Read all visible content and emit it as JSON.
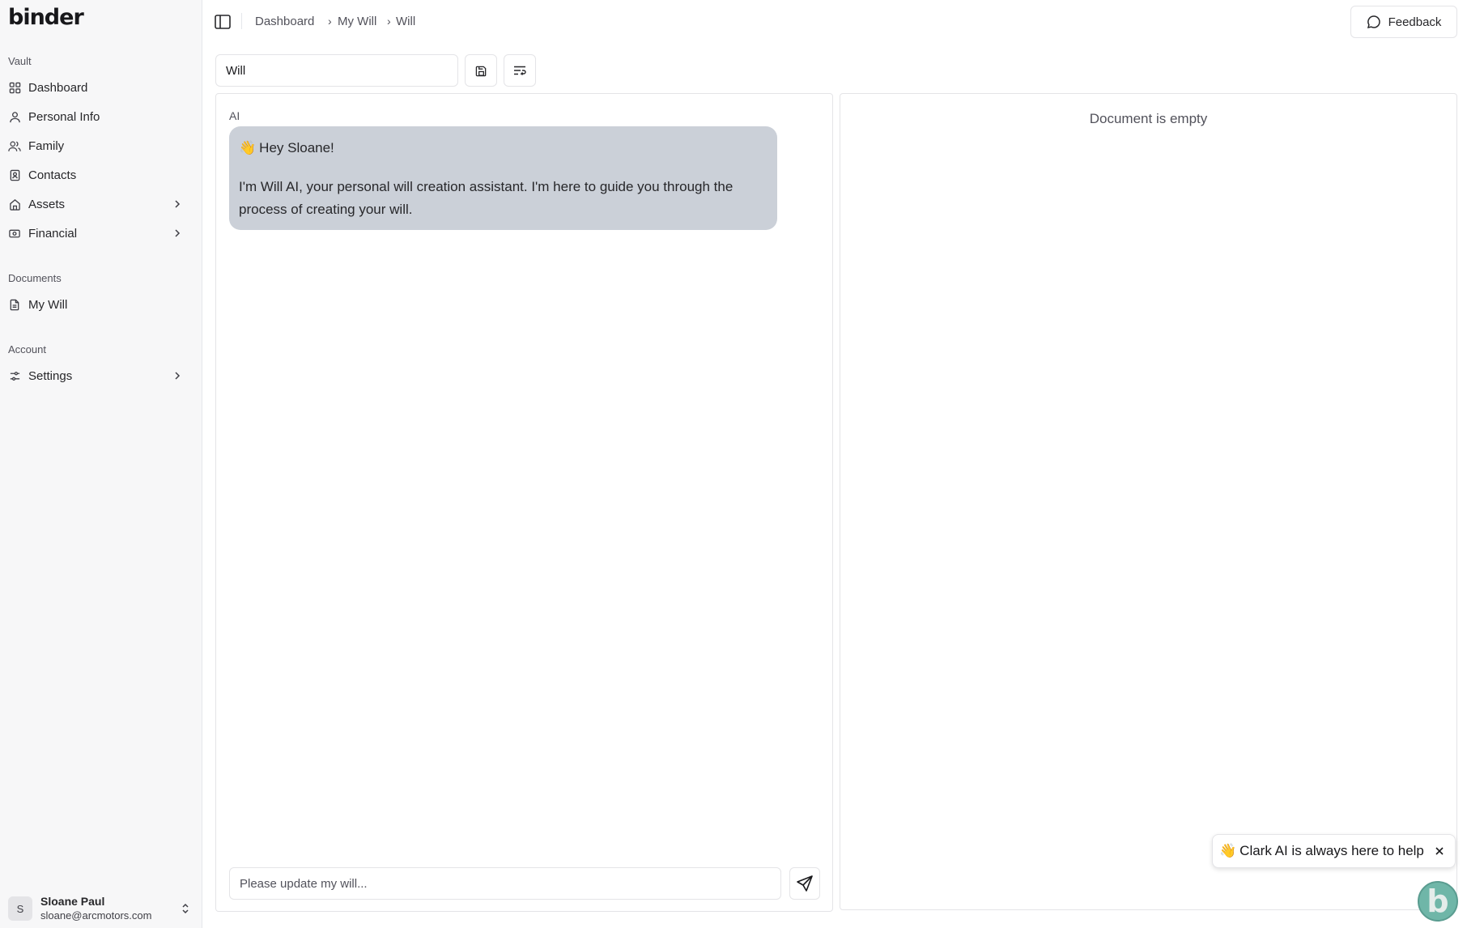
{
  "app": {
    "logo": "binder"
  },
  "sidebar": {
    "groups": [
      {
        "label": "Vault"
      },
      {
        "label": "Documents"
      },
      {
        "label": "Account"
      }
    ],
    "items": [
      {
        "label": "Dashboard",
        "icon": "grid-icon"
      },
      {
        "label": "Personal Info",
        "icon": "user-icon"
      },
      {
        "label": "Family",
        "icon": "users-icon"
      },
      {
        "label": "Contacts",
        "icon": "contact-book-icon"
      },
      {
        "label": "Assets",
        "icon": "home-icon",
        "expandable": true
      },
      {
        "label": "Financial",
        "icon": "banknote-icon",
        "expandable": true
      },
      {
        "label": "My Will",
        "icon": "file-icon"
      },
      {
        "label": "Settings",
        "icon": "sliders-icon",
        "expandable": true
      }
    ],
    "user": {
      "initial": "S",
      "name": "Sloane Paul",
      "email": "sloane@arcmotors.com"
    }
  },
  "header": {
    "breadcrumb": [
      "Dashboard",
      "My Will",
      "Will"
    ],
    "feedback_label": "Feedback"
  },
  "toolbar": {
    "title_value": "Will"
  },
  "chat": {
    "sender_label": "AI",
    "message_greeting_emoji": "👋",
    "message_greeting": "Hey Sloane!",
    "message_body": "I'm Will AI, your personal will creation assistant. I'm here to guide you through the process of creating your will.",
    "input_placeholder": "Please update my will..."
  },
  "document": {
    "empty_text": "Document is empty"
  },
  "help": {
    "emoji": "👋",
    "text": "Clark AI is always here to help",
    "fab_letter": "b"
  },
  "colors": {
    "bubble": "#cbd0d8",
    "fab": "#6fb6a8",
    "sidebar_bg": "#f7f7f8"
  }
}
